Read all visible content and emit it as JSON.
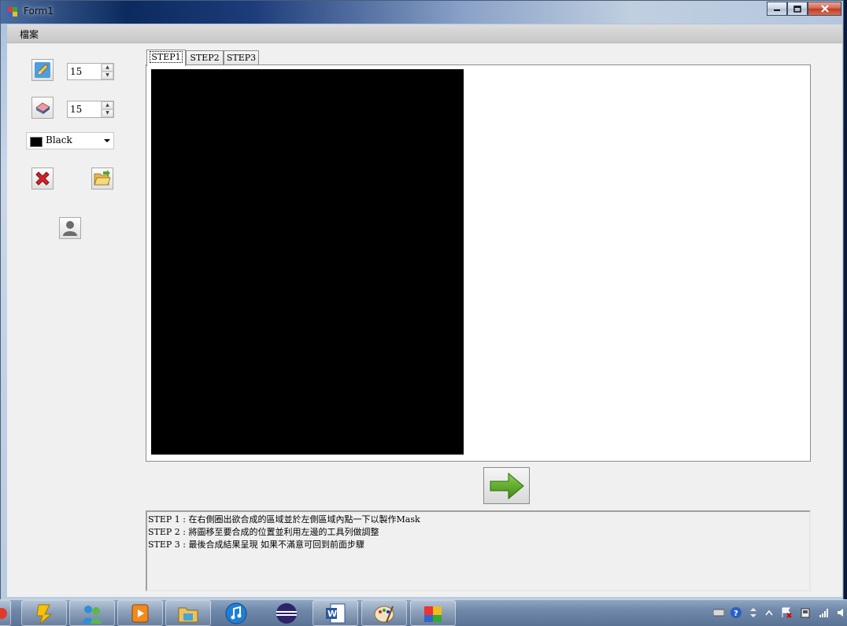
{
  "window": {
    "title": "Form1"
  },
  "menu": {
    "file": "檔案"
  },
  "tools": {
    "pen_size": "15",
    "eraser_size": "15",
    "color": {
      "label": "Black",
      "value": "#000000"
    }
  },
  "tabs": [
    "STEP1",
    "STEP2",
    "STEP3"
  ],
  "instructions": [
    "STEP 1 : 在右側圈出欲合成的區域並於左側區域內點一下以製作Mask",
    "STEP 2 : 將圖移至要合成的位置並利用左邊的工具列做調整",
    "STEP 3 : 最後合成結果呈現  如果不滿意可回到前面步驟"
  ],
  "taskbar": {
    "pinned": [
      "app-icon",
      "people-icon",
      "media-player-icon",
      "explorer-icon",
      "itunes-icon",
      "eclipse-icon",
      "word-icon",
      "paint-icon",
      "form-app-icon"
    ]
  },
  "colors": {
    "accent_green": "#4c9a1f",
    "delete_red": "#d4232a"
  }
}
